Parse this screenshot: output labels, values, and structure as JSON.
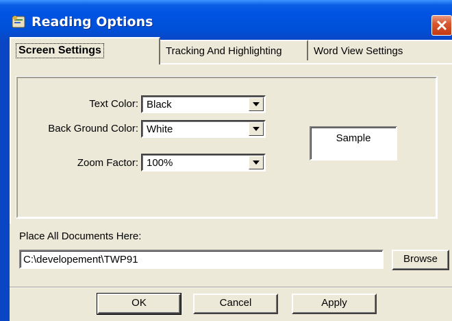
{
  "window": {
    "title": "Reading Options"
  },
  "tabs": [
    {
      "label": "Screen  Settings",
      "active": true
    },
    {
      "label": "Tracking And Highlighting",
      "active": false
    },
    {
      "label": "Word View Settings",
      "active": false
    }
  ],
  "screen_settings": {
    "text_color": {
      "label": "Text Color:",
      "value": "Black"
    },
    "background_color": {
      "label": "Back Ground  Color:",
      "value": "White"
    },
    "zoom_factor": {
      "label": "Zoom Factor:",
      "value": "100%"
    },
    "sample": "Sample"
  },
  "documents": {
    "label": "Place All Documents Here:",
    "path": "C:\\developement\\TWP91",
    "browse": "Browse"
  },
  "buttons": {
    "ok": "OK",
    "cancel": "Cancel",
    "apply": "Apply"
  },
  "colors": {
    "titlebar": "#0054e3",
    "face": "#ece9d8",
    "close": "#d9572f"
  },
  "icons": [
    "app-icon",
    "close-icon",
    "chevron-down-icon"
  ]
}
